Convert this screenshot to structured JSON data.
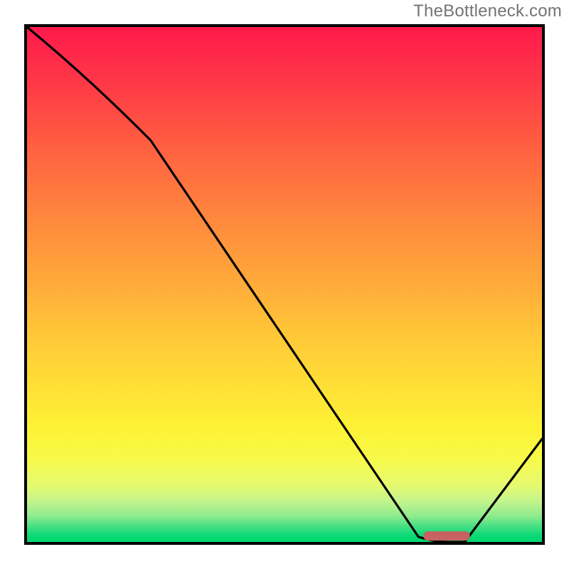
{
  "watermark": "TheBottleneck.com",
  "chart_data": {
    "type": "line",
    "title": "",
    "xlabel": "",
    "ylabel": "",
    "xlim": [
      0,
      100
    ],
    "ylim": [
      0,
      100
    ],
    "grid": false,
    "series": [
      {
        "name": "bottleneck-curve",
        "x": [
          0,
          24,
          76,
          82,
          85,
          100
        ],
        "y": [
          100,
          78,
          1,
          0,
          0,
          20
        ]
      }
    ],
    "annotations": [
      {
        "name": "optimal-range-marker",
        "shape": "rounded-bar",
        "x_start": 77,
        "x_end": 86,
        "y": 0.5,
        "color": "#c86262"
      }
    ],
    "background": {
      "type": "vertical-gradient",
      "stops": [
        {
          "pos": 0.0,
          "color": "#ff1a4b"
        },
        {
          "pos": 0.5,
          "color": "#ffab3a"
        },
        {
          "pos": 0.8,
          "color": "#f7fa4a"
        },
        {
          "pos": 1.0,
          "color": "#02d771"
        }
      ]
    }
  }
}
